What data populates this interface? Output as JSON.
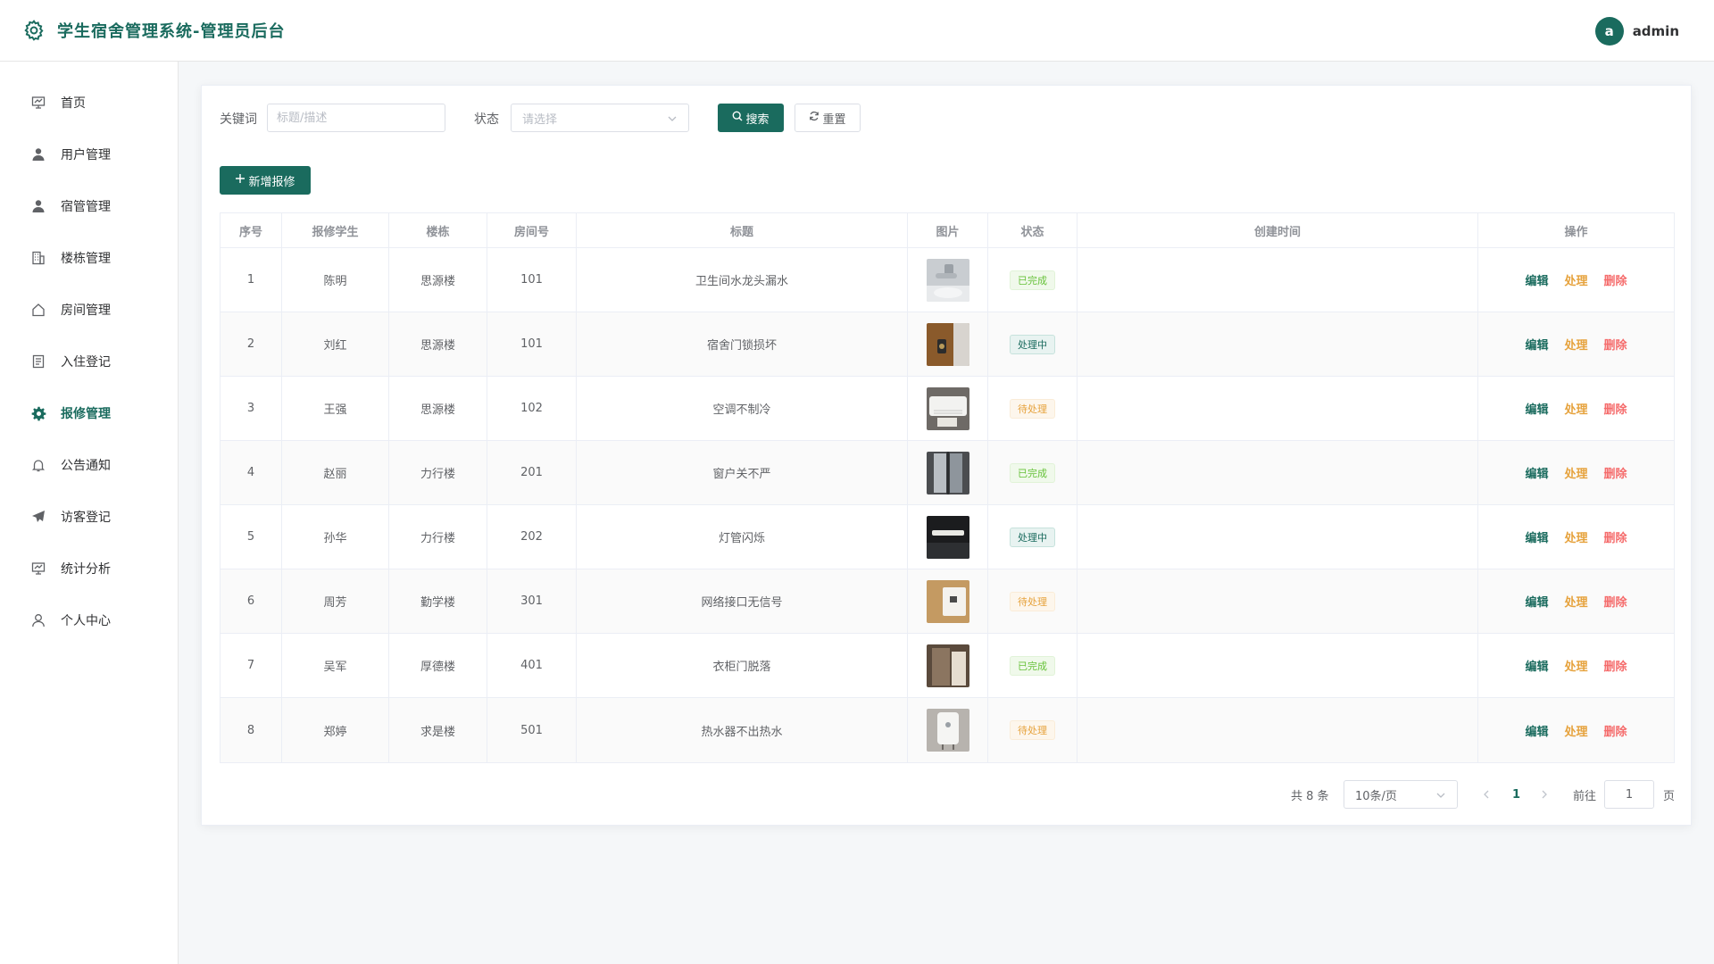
{
  "header": {
    "title": "学生宿舍管理系统-管理员后台",
    "avatar_letter": "a",
    "username": "admin"
  },
  "sidebar": {
    "items": [
      {
        "label": "首页",
        "icon": "presentation-icon"
      },
      {
        "label": "用户管理",
        "icon": "user-icon"
      },
      {
        "label": "宿管管理",
        "icon": "user-icon"
      },
      {
        "label": "楼栋管理",
        "icon": "building-icon"
      },
      {
        "label": "房间管理",
        "icon": "house-icon"
      },
      {
        "label": "入住登记",
        "icon": "document-icon"
      },
      {
        "label": "报修管理",
        "icon": "gear-icon",
        "active": true
      },
      {
        "label": "公告通知",
        "icon": "bell-icon"
      },
      {
        "label": "访客登记",
        "icon": "send-icon"
      },
      {
        "label": "统计分析",
        "icon": "presentation-icon"
      },
      {
        "label": "个人中心",
        "icon": "user-outline-icon"
      }
    ]
  },
  "filters": {
    "keyword_label": "关键词",
    "keyword_placeholder": "标题/描述",
    "status_label": "状态",
    "status_placeholder": "请选择",
    "search_label": "搜索",
    "reset_label": "重置"
  },
  "actions": {
    "add_label": "新增报修"
  },
  "table": {
    "columns": [
      "序号",
      "报修学生",
      "楼栋",
      "房间号",
      "标题",
      "图片",
      "状态",
      "创建时间",
      "操作"
    ],
    "op_labels": {
      "edit": "编辑",
      "handle": "处理",
      "delete": "删除"
    },
    "rows": [
      {
        "no": "1",
        "student": "陈明",
        "building": "思源楼",
        "room": "101",
        "title": "卫生间水龙头漏水",
        "image": "faucet-photo",
        "status": "已完成",
        "created": ""
      },
      {
        "no": "2",
        "student": "刘红",
        "building": "思源楼",
        "room": "101",
        "title": "宿舍门锁损坏",
        "image": "door-lock-photo",
        "status": "处理中",
        "created": ""
      },
      {
        "no": "3",
        "student": "王强",
        "building": "思源楼",
        "room": "102",
        "title": "空调不制冷",
        "image": "air-conditioner-photo",
        "status": "待处理",
        "created": ""
      },
      {
        "no": "4",
        "student": "赵丽",
        "building": "力行楼",
        "room": "201",
        "title": "窗户关不严",
        "image": "window-photo",
        "status": "已完成",
        "created": ""
      },
      {
        "no": "5",
        "student": "孙华",
        "building": "力行楼",
        "room": "202",
        "title": "灯管闪烁",
        "image": "lamp-photo",
        "status": "处理中",
        "created": ""
      },
      {
        "no": "6",
        "student": "周芳",
        "building": "勤学楼",
        "room": "301",
        "title": "网络接口无信号",
        "image": "network-port-photo",
        "status": "待处理",
        "created": ""
      },
      {
        "no": "7",
        "student": "吴军",
        "building": "厚德楼",
        "room": "401",
        "title": "衣柜门脱落",
        "image": "wardrobe-photo",
        "status": "已完成",
        "created": ""
      },
      {
        "no": "8",
        "student": "郑婷",
        "building": "求是楼",
        "room": "501",
        "title": "热水器不出热水",
        "image": "water-heater-photo",
        "status": "待处理",
        "created": ""
      }
    ]
  },
  "pagination": {
    "total_text": "共 8 条",
    "page_size": "10条/页",
    "current_page": "1",
    "goto_prefix": "前往",
    "goto_value": "1",
    "goto_suffix": "页"
  },
  "colors": {
    "primary": "#1a6b5e",
    "success": "#67c23a",
    "warning": "#e6a23c",
    "danger": "#f56c6c"
  }
}
